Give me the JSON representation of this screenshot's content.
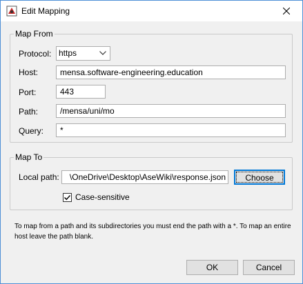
{
  "window": {
    "title": "Edit Mapping"
  },
  "map_from": {
    "legend": "Map From",
    "protocol_label": "Protocol:",
    "protocol_value": "https",
    "host_label": "Host:",
    "host_value": "mensa.software-engineering.education",
    "port_label": "Port:",
    "port_value": "443",
    "path_label": "Path:",
    "path_value": "/mensa/uni/mo",
    "query_label": "Query:",
    "query_value": "*"
  },
  "map_to": {
    "legend": "Map To",
    "local_path_label": "Local path:",
    "local_path_value": "\\OneDrive\\Desktop\\AseWiki\\response.json",
    "choose_label": "Choose",
    "case_sensitive_label": "Case-sensitive",
    "case_sensitive_checked": true
  },
  "hint": "To map from a path and its subdirectories you must end the path with a *. To map an entire host leave the path blank.",
  "buttons": {
    "ok": "OK",
    "cancel": "Cancel"
  }
}
